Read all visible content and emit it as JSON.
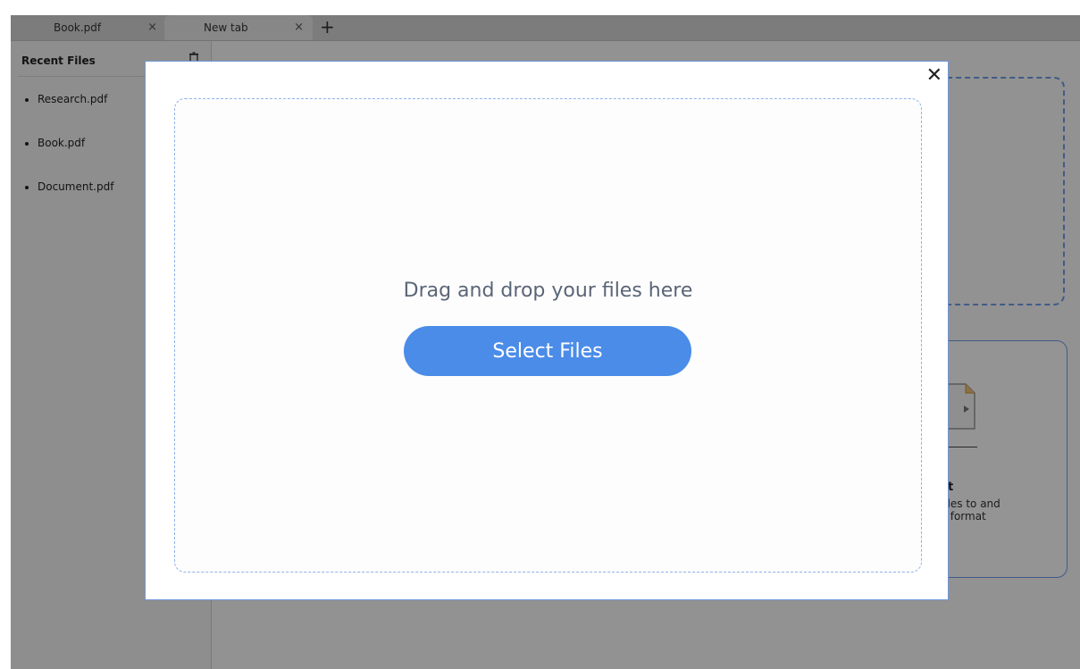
{
  "tabs": [
    {
      "label": "Book.pdf",
      "close": "×"
    },
    {
      "label": "New tab",
      "close": "×"
    }
  ],
  "new_tab_label": "+",
  "sidebar": {
    "title": "Recent Files",
    "items": [
      "Research.pdf",
      "Book.pdf",
      "Document.pdf"
    ]
  },
  "background": {
    "card_title": "t",
    "card_desc": "files to and\nF format"
  },
  "modal": {
    "close_label": "✕",
    "drop_text": "Drag and drop your files here",
    "select_button": "Select Files"
  },
  "colors": {
    "accent": "#4b8ce8",
    "border": "#6e97d6"
  }
}
